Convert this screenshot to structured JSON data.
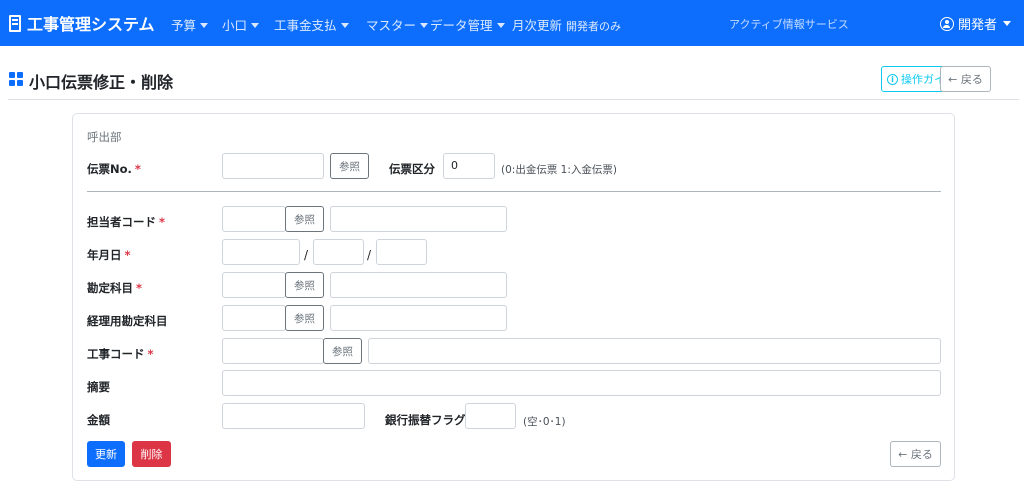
{
  "navbar": {
    "brand": "工事管理システム",
    "items": [
      {
        "label": "予算"
      },
      {
        "label": "小口"
      },
      {
        "label": "工事金支払"
      },
      {
        "label": "マスター"
      },
      {
        "label": "データ管理"
      }
    ],
    "monthly": {
      "label": "月次更新",
      "note": "開発者のみ"
    },
    "center_text": "アクティブ情報サービス",
    "user": "開発者"
  },
  "page": {
    "title": "小口伝票修正・削除",
    "guide_button": "操作ガイド",
    "back_button": "← 戻る"
  },
  "form": {
    "section_label": "呼出部",
    "voucher_no": {
      "label": "伝票No.",
      "value": "",
      "ref": "参照"
    },
    "voucher_type": {
      "label": "伝票区分",
      "value": "0",
      "hint": "(0:出金伝票 1:入金伝票)"
    },
    "staff_code": {
      "label": "担当者コード",
      "ref": "参照"
    },
    "date": {
      "label": "年月日",
      "separator": "/"
    },
    "account": {
      "label": "勘定科目",
      "ref": "参照"
    },
    "mgmt_account": {
      "label": "経理用勘定科目",
      "ref": "参照"
    },
    "project_code": {
      "label": "工事コード",
      "ref": "参照"
    },
    "summary": {
      "label": "摘要"
    },
    "amount": {
      "label": "金額"
    },
    "bank_flag": {
      "label": "銀行振替フラグ",
      "hint": "(空･0･1)"
    },
    "required_mark": "*",
    "update_button": "更新",
    "delete_button": "削除",
    "back_button": "← 戻る"
  },
  "colors": {
    "primary": "#0d6efd",
    "danger": "#dc3545",
    "info": "#0dcaf0"
  }
}
